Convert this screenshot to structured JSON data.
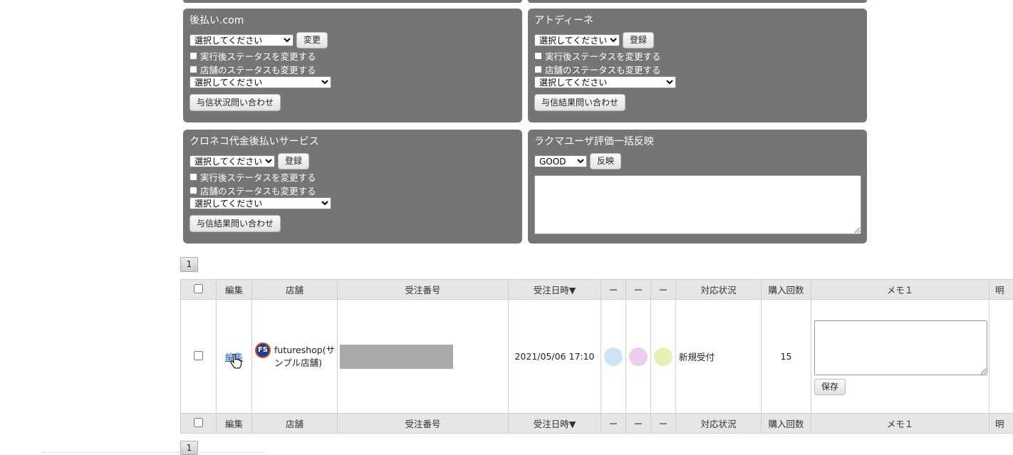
{
  "panels": {
    "atobarai": {
      "title": "後払い.com",
      "select_value": "選択してください",
      "button": "変更",
      "check1": "実行後ステータスを変更する",
      "check2": "店舗のステータスも変更する",
      "status_select": "選択してください",
      "query_button": "与信状況問い合わせ"
    },
    "atodine": {
      "title": "アトディーネ",
      "select_value": "選択してください",
      "button": "登録",
      "check1": "実行後ステータスを変更する",
      "check2": "店舗のステータスも変更する",
      "status_select": "選択してください",
      "query_button": "与信結果問い合わせ"
    },
    "kuroneko": {
      "title": "クロネコ代金後払いサービス",
      "select_value": "選択してください",
      "button": "登録",
      "check1": "実行後ステータスを変更する",
      "check2": "店舗のステータスも変更する",
      "status_select": "選択してください",
      "query_button": "与信結果問い合わせ"
    },
    "rakuma": {
      "title": "ラクマユーザ評価一括反映",
      "select_value": "GOOD",
      "button": "反映",
      "textarea_value": ""
    }
  },
  "pager": {
    "page": "1"
  },
  "table": {
    "headers": {
      "edit": "編集",
      "shop": "店舗",
      "order_no": "受注番号",
      "order_date": "受注日時▼",
      "flag1": "ー",
      "flag2": "ー",
      "flag3": "ー",
      "status": "対応状況",
      "purchase_count": "購入回数",
      "memo": "メモ１",
      "detail": "明"
    },
    "row": {
      "edit_link": "編集",
      "shop_icon_text": "FS",
      "shop_name": "futureshop(サンプル店舗)",
      "order_date": "2021/05/06 17:10",
      "status": "新規受付",
      "purchase_count": "15",
      "memo_value": "",
      "save_button": "保存"
    }
  },
  "colors": {
    "panel_bg": "#757575",
    "dot1": "#cfe3f7",
    "dot2": "#ebcdec",
    "dot3": "#e7f0b4",
    "link_header": "#8a1a8a"
  }
}
